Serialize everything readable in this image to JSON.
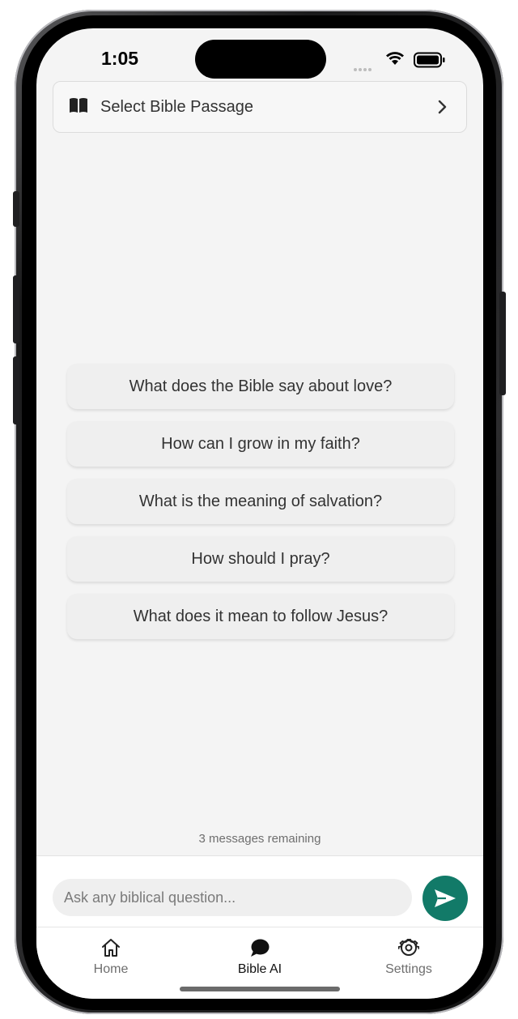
{
  "status_bar": {
    "time": "1:05",
    "icons": [
      "signal-icon",
      "wifi-icon",
      "battery-icon"
    ]
  },
  "passage_selector": {
    "icon": "book-icon",
    "label": "Select Bible Passage",
    "trailing_icon": "chevron-right-icon"
  },
  "suggestions": [
    "What does the Bible say about love?",
    "How can I grow in my faith?",
    "What is the meaning of salvation?",
    "How should I pray?",
    "What does it mean to follow Jesus?"
  ],
  "messages_remaining": "3 messages remaining",
  "composer": {
    "placeholder": "Ask any biblical question...",
    "value": "",
    "send_icon": "send-icon"
  },
  "tabs": [
    {
      "label": "Home",
      "icon": "home-icon",
      "active": false
    },
    {
      "label": "Bible AI",
      "icon": "chat-bubble-icon",
      "active": true
    },
    {
      "label": "Settings",
      "icon": "gear-icon",
      "active": false
    }
  ],
  "colors": {
    "accent": "#127a68",
    "background": "#f4f4f4",
    "suggestion_bg": "#efefef",
    "text": "#333333",
    "muted_text": "#6e6e6e"
  }
}
